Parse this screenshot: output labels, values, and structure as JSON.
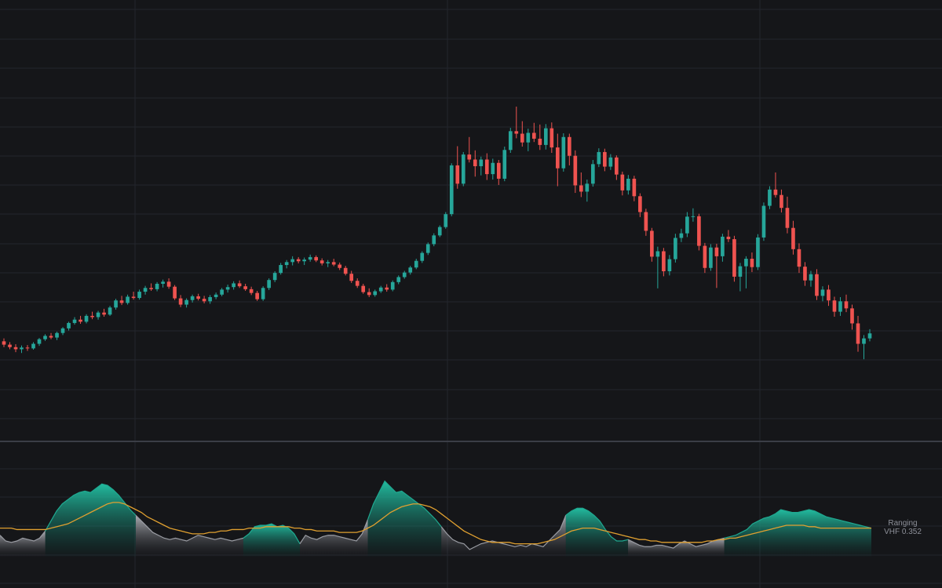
{
  "colors": {
    "background": "#151619",
    "grid": "#23262d",
    "divider": "#3b3e46",
    "up": "#26a69a",
    "down": "#ef5350",
    "trending_fill": "#1fa890",
    "ranging_fill": "#9a9ca3",
    "signal_line": "#e0a030",
    "label_text": "#8d9099"
  },
  "indicator": {
    "status_label": "Ranging",
    "value_label": "VHF 0.352"
  },
  "chart_data": [
    {
      "type": "candlestick",
      "title": "",
      "candle_count": 150,
      "ylim": [
        85,
        170
      ],
      "grid": true,
      "key_closes": [
        {
          "i": 0,
          "close": 103
        },
        {
          "i": 5,
          "close": 101.5
        },
        {
          "i": 10,
          "close": 108
        },
        {
          "i": 18,
          "close": 114
        },
        {
          "i": 24,
          "close": 117
        },
        {
          "i": 28,
          "close": 121
        },
        {
          "i": 28,
          "close": 121
        },
        {
          "i": 28,
          "close": 119
        }
      ],
      "ohlc_generation": "approximated from visual trace"
    },
    {
      "type": "area",
      "title": "",
      "series": [
        {
          "name": "VHF",
          "role": "area"
        },
        {
          "name": "",
          "role": "signal"
        }
      ],
      "last_value": 0.352,
      "state": "Ranging"
    }
  ],
  "candles": [
    [
      102.8,
      103.5,
      101.4,
      102.0
    ],
    [
      102.0,
      102.6,
      100.9,
      101.4
    ],
    [
      101.4,
      102.1,
      100.2,
      100.9
    ],
    [
      100.9,
      101.8,
      100.0,
      101.3
    ],
    [
      101.3,
      101.9,
      100.5,
      101.1
    ],
    [
      101.1,
      102.6,
      100.8,
      102.2
    ],
    [
      102.2,
      103.6,
      101.7,
      103.3
    ],
    [
      103.3,
      104.5,
      102.9,
      104.1
    ],
    [
      104.1,
      104.8,
      103.3,
      103.7
    ],
    [
      103.7,
      105.1,
      103.1,
      104.8
    ],
    [
      104.8,
      106.2,
      104.3,
      105.9
    ],
    [
      105.9,
      107.5,
      105.4,
      107.2
    ],
    [
      107.2,
      108.6,
      106.8,
      108.0
    ],
    [
      108.0,
      108.9,
      107.0,
      107.5
    ],
    [
      107.5,
      109.3,
      107.1,
      108.9
    ],
    [
      108.9,
      109.9,
      108.1,
      108.6
    ],
    [
      108.6,
      110.1,
      108.0,
      109.7
    ],
    [
      109.7,
      110.6,
      108.7,
      109.2
    ],
    [
      109.2,
      111.3,
      108.9,
      110.9
    ],
    [
      110.9,
      113.0,
      110.4,
      112.6
    ],
    [
      112.6,
      113.7,
      111.5,
      112.0
    ],
    [
      112.0,
      114.0,
      111.6,
      113.5
    ],
    [
      113.5,
      114.7,
      112.8,
      113.2
    ],
    [
      113.2,
      115.2,
      112.8,
      114.7
    ],
    [
      114.7,
      116.1,
      114.0,
      115.6
    ],
    [
      115.6,
      116.7,
      114.9,
      115.3
    ],
    [
      115.3,
      117.0,
      114.8,
      116.6
    ],
    [
      116.6,
      117.6,
      115.7,
      117.1
    ],
    [
      117.1,
      117.9,
      115.4,
      115.9
    ],
    [
      115.9,
      116.3,
      112.7,
      113.1
    ],
    [
      113.1,
      113.9,
      111.0,
      111.6
    ],
    [
      111.6,
      113.1,
      110.9,
      112.7
    ],
    [
      112.7,
      114.0,
      112.1,
      113.6
    ],
    [
      113.6,
      114.2,
      112.6,
      113.0
    ],
    [
      113.0,
      113.7,
      111.9,
      112.4
    ],
    [
      112.4,
      113.9,
      111.8,
      113.4
    ],
    [
      113.4,
      114.5,
      112.9,
      114.0
    ],
    [
      114.0,
      115.6,
      113.6,
      115.2
    ],
    [
      115.2,
      116.4,
      114.5,
      115.8
    ],
    [
      115.8,
      117.2,
      115.2,
      116.7
    ],
    [
      116.7,
      117.4,
      115.6,
      116.0
    ],
    [
      116.0,
      116.6,
      114.9,
      115.3
    ],
    [
      115.3,
      115.9,
      113.9,
      114.4
    ],
    [
      114.4,
      114.9,
      112.5,
      112.9
    ],
    [
      112.9,
      116.0,
      112.5,
      115.6
    ],
    [
      115.6,
      117.9,
      115.1,
      117.5
    ],
    [
      117.5,
      119.6,
      117.0,
      119.2
    ],
    [
      119.2,
      121.6,
      118.8,
      121.1
    ],
    [
      121.1,
      122.3,
      120.3,
      121.8
    ],
    [
      121.8,
      123.2,
      121.0,
      122.5
    ],
    [
      122.5,
      123.0,
      121.5,
      122.0
    ],
    [
      122.0,
      122.9,
      121.1,
      122.4
    ],
    [
      122.4,
      123.6,
      121.9,
      123.0
    ],
    [
      123.0,
      123.4,
      121.8,
      122.2
    ],
    [
      122.2,
      122.7,
      121.0,
      121.5
    ],
    [
      121.5,
      122.3,
      120.6,
      121.8
    ],
    [
      121.8,
      122.6,
      120.8,
      121.2
    ],
    [
      121.2,
      121.7,
      119.9,
      120.4
    ],
    [
      120.4,
      120.9,
      118.6,
      119.0
    ],
    [
      119.0,
      119.7,
      116.8,
      117.3
    ],
    [
      117.3,
      117.9,
      115.6,
      116.1
    ],
    [
      116.1,
      116.6,
      114.2,
      114.6
    ],
    [
      114.6,
      115.5,
      113.4,
      113.9
    ],
    [
      113.9,
      115.2,
      113.5,
      114.8
    ],
    [
      114.8,
      116.1,
      114.4,
      115.7
    ],
    [
      115.7,
      116.5,
      114.7,
      115.2
    ],
    [
      115.2,
      117.4,
      114.8,
      117.0
    ],
    [
      117.0,
      118.6,
      116.5,
      118.2
    ],
    [
      118.2,
      119.7,
      117.8,
      119.3
    ],
    [
      119.3,
      120.9,
      118.8,
      120.5
    ],
    [
      120.5,
      122.6,
      120.1,
      122.1
    ],
    [
      122.1,
      124.4,
      121.6,
      124.0
    ],
    [
      124.0,
      126.5,
      123.5,
      126.1
    ],
    [
      126.1,
      128.7,
      125.6,
      128.2
    ],
    [
      128.2,
      130.6,
      127.8,
      130.2
    ],
    [
      130.2,
      133.8,
      129.8,
      133.3
    ],
    [
      133.3,
      145.5,
      132.8,
      145.0
    ],
    [
      145.0,
      149.6,
      139.4,
      140.6
    ],
    [
      140.6,
      148.2,
      140.0,
      147.6
    ],
    [
      147.6,
      151.8,
      145.7,
      146.4
    ],
    [
      146.4,
      148.6,
      142.3,
      144.8
    ],
    [
      144.8,
      147.1,
      142.6,
      146.4
    ],
    [
      146.4,
      147.9,
      141.5,
      142.9
    ],
    [
      142.9,
      146.6,
      141.6,
      145.6
    ],
    [
      145.6,
      146.3,
      140.3,
      141.8
    ],
    [
      141.8,
      149.5,
      141.2,
      148.7
    ],
    [
      148.7,
      154.0,
      148.0,
      153.2
    ],
    [
      153.2,
      159.1,
      151.5,
      152.6
    ],
    [
      152.6,
      155.6,
      149.5,
      150.5
    ],
    [
      150.5,
      153.8,
      148.4,
      152.8
    ],
    [
      152.8,
      155.2,
      150.6,
      151.4
    ],
    [
      151.4,
      154.8,
      148.7,
      149.9
    ],
    [
      149.9,
      154.9,
      148.8,
      153.9
    ],
    [
      153.9,
      155.3,
      148.0,
      149.3
    ],
    [
      149.3,
      152.6,
      140.0,
      144.3
    ],
    [
      144.3,
      152.7,
      143.5,
      151.8
    ],
    [
      151.8,
      152.6,
      145.0,
      147.3
    ],
    [
      147.3,
      148.6,
      138.4,
      140.2
    ],
    [
      140.2,
      143.3,
      137.4,
      138.7
    ],
    [
      138.7,
      141.6,
      136.3,
      140.6
    ],
    [
      140.6,
      146.3,
      139.9,
      145.3
    ],
    [
      145.3,
      149.1,
      144.6,
      148.2
    ],
    [
      148.2,
      149.0,
      143.6,
      144.7
    ],
    [
      144.7,
      147.7,
      143.9,
      146.9
    ],
    [
      146.9,
      147.4,
      141.5,
      142.8
    ],
    [
      142.8,
      143.5,
      137.8,
      139.0
    ],
    [
      139.0,
      142.7,
      138.0,
      141.8
    ],
    [
      141.8,
      142.5,
      136.4,
      137.6
    ],
    [
      137.6,
      138.3,
      132.6,
      133.8
    ],
    [
      133.8,
      134.6,
      128.1,
      129.3
    ],
    [
      129.3,
      130.0,
      121.9,
      123.1
    ],
    [
      123.1,
      125.5,
      115.5,
      124.4
    ],
    [
      124.4,
      125.2,
      118.4,
      119.6
    ],
    [
      119.6,
      123.5,
      118.6,
      122.5
    ],
    [
      122.5,
      128.6,
      121.7,
      127.6
    ],
    [
      127.6,
      129.8,
      126.6,
      128.7
    ],
    [
      128.7,
      133.8,
      127.8,
      132.7
    ],
    [
      132.7,
      134.7,
      131.5,
      132.8
    ],
    [
      132.8,
      133.4,
      124.6,
      125.7
    ],
    [
      125.7,
      126.4,
      119.2,
      120.4
    ],
    [
      120.4,
      126.1,
      119.7,
      125.3
    ],
    [
      125.3,
      126.2,
      115.6,
      123.2
    ],
    [
      123.2,
      128.6,
      121.9,
      127.9
    ],
    [
      127.9,
      129.5,
      126.6,
      127.3
    ],
    [
      127.3,
      128.1,
      117.1,
      118.3
    ],
    [
      118.3,
      121.6,
      114.8,
      120.8
    ],
    [
      120.8,
      123.2,
      115.5,
      122.6
    ],
    [
      122.6,
      124.1,
      119.4,
      120.6
    ],
    [
      120.6,
      128.5,
      119.9,
      127.7
    ],
    [
      127.7,
      136.1,
      126.9,
      135.3
    ],
    [
      135.3,
      140.0,
      134.5,
      139.2
    ],
    [
      139.2,
      143.3,
      137.3,
      137.9
    ],
    [
      137.9,
      139.2,
      133.7,
      134.8
    ],
    [
      134.8,
      137.5,
      128.7,
      130.0
    ],
    [
      130.0,
      131.7,
      123.6,
      124.9
    ],
    [
      124.9,
      126.3,
      119.2,
      120.7
    ],
    [
      120.7,
      121.8,
      116.1,
      117.4
    ],
    [
      117.4,
      119.7,
      115.9,
      118.9
    ],
    [
      118.9,
      120.1,
      112.7,
      113.7
    ],
    [
      113.7,
      116.0,
      112.4,
      115.2
    ],
    [
      115.2,
      116.3,
      111.3,
      112.6
    ],
    [
      112.6,
      113.5,
      108.7,
      109.9
    ],
    [
      109.9,
      113.4,
      108.9,
      112.4
    ],
    [
      112.4,
      114.0,
      109.8,
      110.7
    ],
    [
      110.7,
      111.6,
      105.6,
      107.1
    ],
    [
      107.1,
      108.9,
      100.3,
      102.2
    ],
    [
      102.2,
      104.3,
      98.5,
      103.5
    ],
    [
      103.5,
      105.7,
      102.8,
      104.7
    ]
  ],
  "vhf": [
    0.3,
    0.26,
    0.25,
    0.26,
    0.28,
    0.27,
    0.26,
    0.28,
    0.33,
    0.4,
    0.47,
    0.52,
    0.55,
    0.58,
    0.6,
    0.61,
    0.6,
    0.63,
    0.66,
    0.65,
    0.62,
    0.58,
    0.53,
    0.48,
    0.44,
    0.4,
    0.36,
    0.32,
    0.3,
    0.28,
    0.27,
    0.28,
    0.27,
    0.26,
    0.28,
    0.3,
    0.29,
    0.28,
    0.27,
    0.28,
    0.27,
    0.26,
    0.27,
    0.28,
    0.31,
    0.36,
    0.37,
    0.37,
    0.38,
    0.36,
    0.37,
    0.35,
    0.31,
    0.24,
    0.3,
    0.28,
    0.27,
    0.29,
    0.3,
    0.3,
    0.29,
    0.28,
    0.27,
    0.26,
    0.31,
    0.41,
    0.52,
    0.6,
    0.68,
    0.64,
    0.6,
    0.61,
    0.58,
    0.55,
    0.52,
    0.49,
    0.45,
    0.41,
    0.36,
    0.31,
    0.27,
    0.25,
    0.24,
    0.2,
    0.22,
    0.24,
    0.25,
    0.26,
    0.25,
    0.24,
    0.23,
    0.22,
    0.23,
    0.22,
    0.24,
    0.23,
    0.22,
    0.26,
    0.3,
    0.34,
    0.44,
    0.47,
    0.49,
    0.49,
    0.47,
    0.44,
    0.4,
    0.34,
    0.29,
    0.26,
    0.26,
    0.27,
    0.25,
    0.23,
    0.22,
    0.22,
    0.23,
    0.23,
    0.22,
    0.21,
    0.24,
    0.26,
    0.24,
    0.22,
    0.23,
    0.24,
    0.26,
    0.27,
    0.28,
    0.29,
    0.3,
    0.32,
    0.34,
    0.38,
    0.4,
    0.42,
    0.43,
    0.45,
    0.48,
    0.47,
    0.46,
    0.46,
    0.47,
    0.48,
    0.47,
    0.45,
    0.43,
    0.42,
    0.41,
    0.4,
    0.39,
    0.38,
    0.37,
    0.36,
    0.35
  ],
  "signal": [
    0.35,
    0.35,
    0.35,
    0.34,
    0.34,
    0.34,
    0.34,
    0.34,
    0.34,
    0.35,
    0.36,
    0.37,
    0.38,
    0.4,
    0.42,
    0.44,
    0.46,
    0.48,
    0.5,
    0.52,
    0.53,
    0.53,
    0.52,
    0.5,
    0.48,
    0.46,
    0.43,
    0.41,
    0.39,
    0.37,
    0.35,
    0.34,
    0.33,
    0.32,
    0.31,
    0.31,
    0.31,
    0.32,
    0.32,
    0.33,
    0.33,
    0.34,
    0.34,
    0.34,
    0.35,
    0.35,
    0.35,
    0.36,
    0.36,
    0.36,
    0.36,
    0.36,
    0.35,
    0.35,
    0.34,
    0.34,
    0.33,
    0.33,
    0.33,
    0.33,
    0.32,
    0.32,
    0.32,
    0.32,
    0.33,
    0.35,
    0.37,
    0.4,
    0.43,
    0.46,
    0.48,
    0.5,
    0.51,
    0.52,
    0.52,
    0.51,
    0.5,
    0.48,
    0.45,
    0.42,
    0.39,
    0.36,
    0.33,
    0.31,
    0.29,
    0.27,
    0.26,
    0.25,
    0.25,
    0.25,
    0.25,
    0.24,
    0.24,
    0.24,
    0.24,
    0.24,
    0.25,
    0.26,
    0.27,
    0.29,
    0.31,
    0.33,
    0.34,
    0.35,
    0.35,
    0.35,
    0.34,
    0.33,
    0.32,
    0.31,
    0.3,
    0.29,
    0.28,
    0.27,
    0.27,
    0.26,
    0.26,
    0.25,
    0.25,
    0.25,
    0.25,
    0.25,
    0.25,
    0.25,
    0.25,
    0.26,
    0.26,
    0.27,
    0.27,
    0.28,
    0.28,
    0.29,
    0.3,
    0.31,
    0.32,
    0.33,
    0.34,
    0.35,
    0.36,
    0.37,
    0.37,
    0.37,
    0.37,
    0.36,
    0.36,
    0.35,
    0.35,
    0.35,
    0.35,
    0.35,
    0.35,
    0.35,
    0.35,
    0.35,
    0.35
  ],
  "vhf_regime": [
    0,
    0,
    0,
    0,
    0,
    0,
    0,
    0,
    1,
    1,
    1,
    1,
    1,
    1,
    1,
    1,
    1,
    1,
    1,
    1,
    1,
    1,
    1,
    1,
    0,
    0,
    0,
    0,
    0,
    0,
    0,
    0,
    0,
    0,
    0,
    0,
    0,
    0,
    0,
    0,
    0,
    0,
    0,
    1,
    1,
    1,
    1,
    1,
    1,
    1,
    1,
    1,
    1,
    0,
    0,
    0,
    0,
    0,
    0,
    0,
    0,
    0,
    0,
    0,
    0,
    1,
    1,
    1,
    1,
    1,
    1,
    1,
    1,
    1,
    1,
    1,
    1,
    1,
    0,
    0,
    0,
    0,
    0,
    0,
    0,
    0,
    0,
    0,
    0,
    0,
    0,
    0,
    0,
    0,
    0,
    0,
    0,
    0,
    0,
    0,
    1,
    1,
    1,
    1,
    1,
    1,
    1,
    1,
    1,
    1,
    1,
    0,
    0,
    0,
    0,
    0,
    0,
    0,
    0,
    0,
    0,
    0,
    0,
    0,
    0,
    0,
    0,
    0,
    1,
    1,
    1,
    1,
    1,
    1,
    1,
    1,
    1,
    1,
    1,
    1,
    1,
    1,
    1,
    1,
    1,
    1,
    1,
    1,
    1,
    1,
    1,
    1,
    1,
    1,
    1
  ]
}
